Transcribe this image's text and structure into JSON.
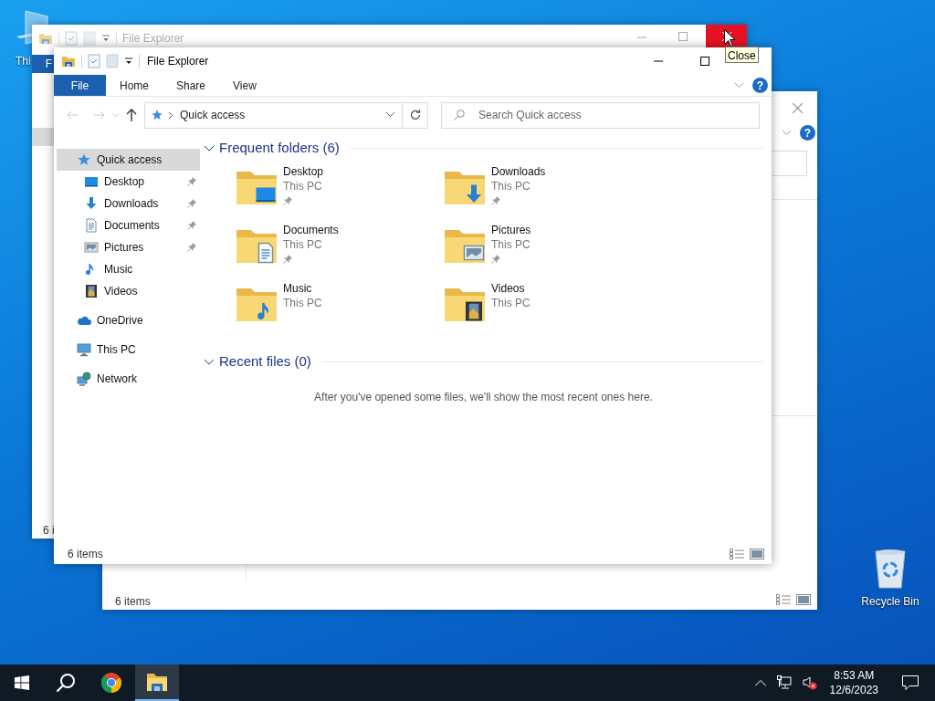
{
  "desktop_icons": [
    {
      "label": "Thi"
    },
    {
      "label": "Recycle Bin"
    }
  ],
  "background_window_1": {
    "title": "File Explorer",
    "close_hovered": true,
    "tooltip": "Close",
    "ribbon_tab": "F",
    "status": "6 i"
  },
  "background_window_2": {
    "help": "?",
    "status": "6 items"
  },
  "window": {
    "title": "File Explorer",
    "help": "?",
    "ribbon_tabs": [
      {
        "label": "File",
        "selected": true
      },
      {
        "label": "Home",
        "selected": false
      },
      {
        "label": "Share",
        "selected": false
      },
      {
        "label": "View",
        "selected": false
      }
    ],
    "address": {
      "path": "Quick access"
    },
    "search": {
      "placeholder": "Search Quick access"
    },
    "navigation": [
      {
        "label": "Quick access",
        "kind": "quick",
        "selected": true,
        "children": [
          {
            "label": "Desktop",
            "kind": "desktop",
            "pinned": true,
            "selected": false
          },
          {
            "label": "Downloads",
            "kind": "downloads",
            "pinned": true,
            "selected": false
          },
          {
            "label": "Documents",
            "kind": "documents",
            "pinned": true,
            "selected": false
          },
          {
            "label": "Pictures",
            "kind": "pictures",
            "pinned": true,
            "selected": false
          },
          {
            "label": "Music",
            "kind": "music",
            "pinned": false,
            "selected": false
          },
          {
            "label": "Videos",
            "kind": "videos",
            "pinned": false,
            "selected": false
          }
        ]
      },
      {
        "label": "OneDrive",
        "kind": "onedrive",
        "selected": false
      },
      {
        "label": "This PC",
        "kind": "pc",
        "selected": false
      },
      {
        "label": "Network",
        "kind": "network",
        "selected": false
      }
    ],
    "sections": [
      {
        "title": "Frequent folders (6)",
        "expanded": true,
        "folders": [
          {
            "name": "Desktop",
            "kind": "desktop",
            "location": "This PC",
            "pinned": true
          },
          {
            "name": "Downloads",
            "kind": "downloads",
            "location": "This PC",
            "pinned": true
          },
          {
            "name": "Documents",
            "kind": "documents",
            "location": "This PC",
            "pinned": true
          },
          {
            "name": "Pictures",
            "kind": "pictures",
            "location": "This PC",
            "pinned": true
          },
          {
            "name": "Music",
            "kind": "music",
            "location": "This PC",
            "pinned": false
          },
          {
            "name": "Videos",
            "kind": "videos",
            "location": "This PC",
            "pinned": false
          }
        ]
      },
      {
        "title": "Recent files (0)",
        "expanded": true,
        "message": "After you've opened some files, we'll show the most recent ones here."
      }
    ],
    "status": "6 items"
  },
  "taskbar": {
    "apps": [
      {
        "kind": "start",
        "active": false
      },
      {
        "kind": "search",
        "active": false
      },
      {
        "kind": "chrome",
        "active": false
      },
      {
        "kind": "explorer",
        "active": true
      }
    ],
    "time": "8:53 AM",
    "date": "12/6/2023"
  }
}
